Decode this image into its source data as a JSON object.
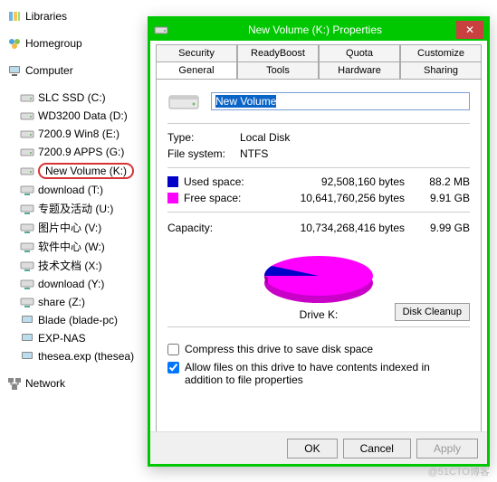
{
  "explorer": {
    "libraries": "Libraries",
    "homegroup": "Homegroup",
    "computer": "Computer",
    "drives": [
      "SLC SSD (C:)",
      "WD3200 Data (D:)",
      "7200.9 Win8 (E:)",
      "7200.9 APPS (G:)",
      "New Volume (K:)",
      "download (T:)",
      "专题及活动 (U:)",
      "图片中心 (V:)",
      "软件中心 (W:)",
      "技术文档 (X:)",
      "download (Y:)",
      "share (Z:)",
      "Blade (blade-pc)",
      "EXP-NAS",
      "thesea.exp (thesea)"
    ],
    "network": "Network"
  },
  "dialog": {
    "title": "New Volume (K:) Properties",
    "tabs_row1": [
      "Security",
      "ReadyBoost",
      "Quota",
      "Customize"
    ],
    "tabs_row2": [
      "General",
      "Tools",
      "Hardware",
      "Sharing"
    ],
    "volume_name": "New Volume",
    "type_label": "Type:",
    "type_value": "Local Disk",
    "fs_label": "File system:",
    "fs_value": "NTFS",
    "used_label": "Used space:",
    "used_bytes": "92,508,160 bytes",
    "used_h": "88.2 MB",
    "free_label": "Free space:",
    "free_bytes": "10,641,760,256 bytes",
    "free_h": "9.91 GB",
    "cap_label": "Capacity:",
    "cap_bytes": "10,734,268,416 bytes",
    "cap_h": "9.99 GB",
    "drive_label": "Drive K:",
    "cleanup": "Disk Cleanup",
    "compress": "Compress this drive to save disk space",
    "index": "Allow files on this drive to have contents indexed in addition to file properties",
    "ok": "OK",
    "cancel": "Cancel",
    "apply": "Apply"
  },
  "watermark": "@51CTO博客",
  "chart_data": {
    "type": "pie",
    "title": "Drive K:",
    "series": [
      {
        "name": "Used space",
        "value": 92508160,
        "color": "#0000c8"
      },
      {
        "name": "Free space",
        "value": 10641760256,
        "color": "#ff00ff"
      }
    ]
  }
}
